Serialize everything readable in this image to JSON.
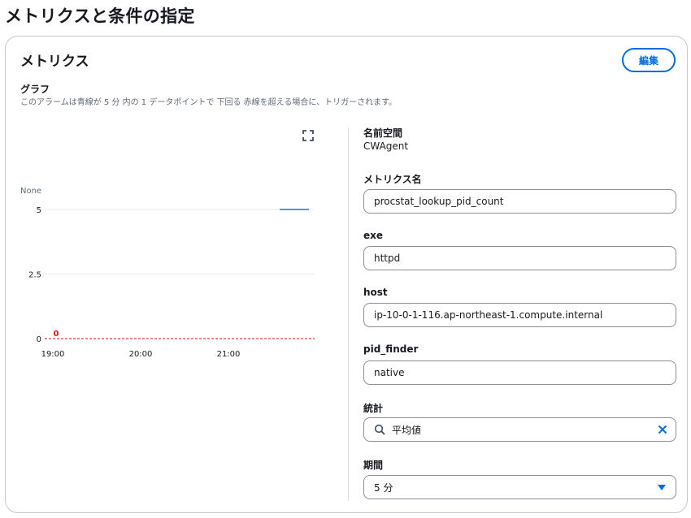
{
  "page_title": "メトリクスと条件の指定",
  "panel": {
    "title": "メトリクス",
    "edit_label": "編集",
    "graph_label": "グラフ",
    "graph_description": "このアラームは青線が 5 分 内の 1 データポイントで 下回る 赤線を超える場合に、トリガーされます。"
  },
  "icons": {
    "expand": "expand-icon",
    "search": "search-icon",
    "clear": "close-icon",
    "dropdown": "caret-down-icon"
  },
  "colors": {
    "accent": "#006ce0",
    "series": "#1f77b4",
    "threshold": "#d91515"
  },
  "chart_data": {
    "type": "line",
    "unit_label": "None",
    "y_ticks": [
      "5",
      "2.5",
      "0"
    ],
    "ylim": [
      0,
      5
    ],
    "x_ticks": [
      "19:00",
      "20:00",
      "21:00"
    ],
    "threshold": {
      "value": 0,
      "label": "0"
    },
    "series": [
      {
        "name": "procstat_lookup_pid_count",
        "x": [
          "21:35",
          "21:55"
        ],
        "values": [
          5,
          5
        ]
      }
    ],
    "legend_position": "bottom-left",
    "grid": true
  },
  "fields": {
    "namespace": {
      "label": "名前空間",
      "value": "CWAgent"
    },
    "metric_name": {
      "label": "メトリクス名",
      "value": "procstat_lookup_pid_count"
    },
    "exe": {
      "label": "exe",
      "value": "httpd"
    },
    "host": {
      "label": "host",
      "value": "ip-10-0-1-116.ap-northeast-1.compute.internal"
    },
    "pid_finder": {
      "label": "pid_finder",
      "value": "native"
    },
    "statistic": {
      "label": "統計",
      "value": "平均値"
    },
    "period": {
      "label": "期間",
      "value": "5 分"
    }
  }
}
